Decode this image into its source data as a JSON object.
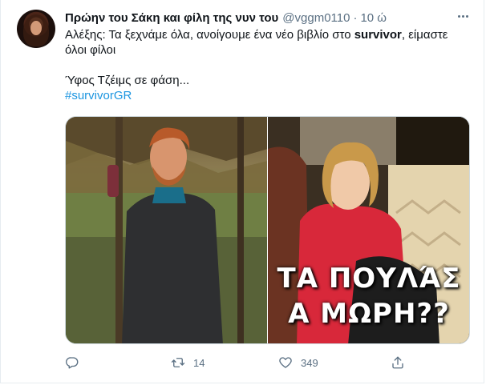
{
  "tweet": {
    "author": {
      "display_name": "Πρώην του Σάκη και φίλη της νυν του",
      "handle": "@vggm0110",
      "separator": "·",
      "time": "10 ώ"
    },
    "text": {
      "line1_prefix": "Αλέξης: Τα ξεχνάμε όλα, ανοίγουμε ένα νέο βιβλίο στο ",
      "line1_strong": "survivor",
      "line1_suffix": ", είμαστε όλοι φίλοι",
      "line2": "Ύφος Τζέιμς σε φάση...",
      "hashtag": "#survivorGR"
    },
    "media": {
      "meme_caption_line1": "ΤΑ ΠΟΥΛΆΣ",
      "meme_caption_line2": "Α ΜΩΡΗ??"
    },
    "actions": {
      "reply_count": "",
      "retweet_count": "14",
      "like_count": "349"
    },
    "colors": {
      "link": "#1b95e0",
      "secondary": "#5b7083"
    },
    "icons": [
      "more-icon",
      "reply-icon",
      "retweet-icon",
      "like-icon",
      "share-icon"
    ]
  }
}
